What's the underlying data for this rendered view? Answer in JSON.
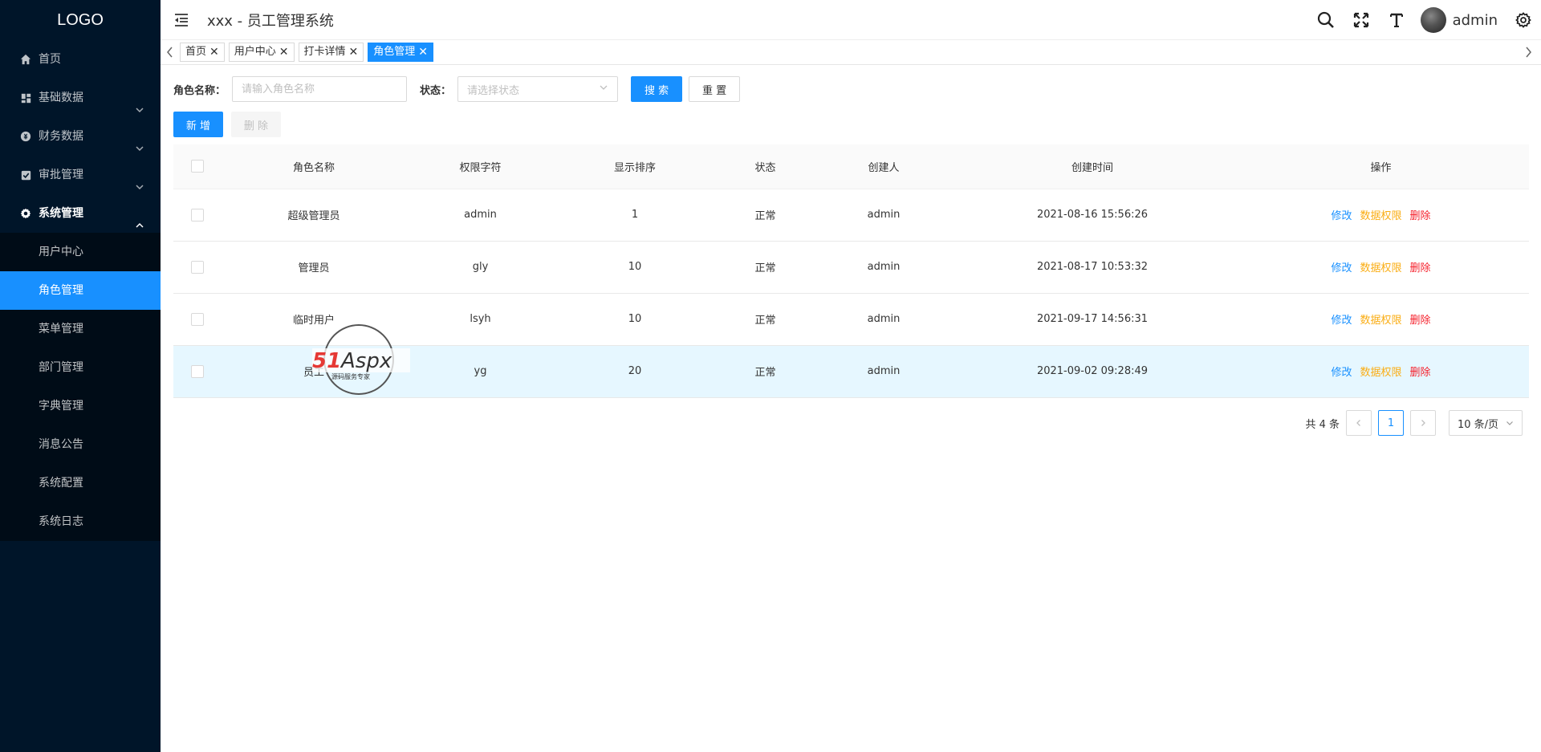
{
  "logo": "LOGO",
  "sidebar": {
    "items": [
      {
        "label": "首页",
        "icon": "home-icon"
      },
      {
        "label": "基础数据",
        "icon": "dashboard-icon"
      },
      {
        "label": "财务数据",
        "icon": "coin-icon"
      },
      {
        "label": "审批管理",
        "icon": "checkbox-icon"
      },
      {
        "label": "系统管理",
        "icon": "gear-icon"
      }
    ],
    "submenu": [
      {
        "label": "用户中心"
      },
      {
        "label": "角色管理"
      },
      {
        "label": "菜单管理"
      },
      {
        "label": "部门管理"
      },
      {
        "label": "字典管理"
      },
      {
        "label": "消息公告"
      },
      {
        "label": "系统配置"
      },
      {
        "label": "系统日志"
      }
    ]
  },
  "header": {
    "title": "xxx - 员工管理系统",
    "username": "admin"
  },
  "tags": [
    {
      "label": "首页"
    },
    {
      "label": "用户中心"
    },
    {
      "label": "打卡详情"
    },
    {
      "label": "角色管理"
    }
  ],
  "search": {
    "role_name_label": "角色名称：",
    "role_name_placeholder": "请输入角色名称",
    "status_label": "状态：",
    "status_placeholder": "请选择状态",
    "search_btn": "搜 索",
    "reset_btn": "重 置"
  },
  "actions": {
    "add_btn": "新 增",
    "delete_btn": "删 除"
  },
  "table": {
    "columns": [
      "角色名称",
      "权限字符",
      "显示排序",
      "状态",
      "创建人",
      "创建时间",
      "操作"
    ],
    "rows": [
      {
        "name": "超级管理员",
        "key": "admin",
        "sort": "1",
        "status": "正常",
        "creator": "admin",
        "time": "2021-08-16 15:56:26"
      },
      {
        "name": "管理员",
        "key": "gly",
        "sort": "10",
        "status": "正常",
        "creator": "admin",
        "time": "2021-08-17 10:53:32"
      },
      {
        "name": "临时用户",
        "key": "lsyh",
        "sort": "10",
        "status": "正常",
        "creator": "admin",
        "time": "2021-09-17 14:56:31"
      },
      {
        "name": "员工",
        "key": "yg",
        "sort": "20",
        "status": "正常",
        "creator": "admin",
        "time": "2021-09-02 09:28:49"
      }
    ],
    "ops": {
      "edit": "修改",
      "perm": "数据权限",
      "del": "删除"
    }
  },
  "pagination": {
    "total": "共 4 条",
    "current": "1",
    "page_size": "10 条/页"
  },
  "watermark": {
    "brand": "51Aspx",
    "sub": "源码服务专家"
  },
  "colors": {
    "sidebar_bg": "#001529",
    "primary": "#1890ff",
    "warning": "#faad14",
    "danger": "#f5222d"
  }
}
